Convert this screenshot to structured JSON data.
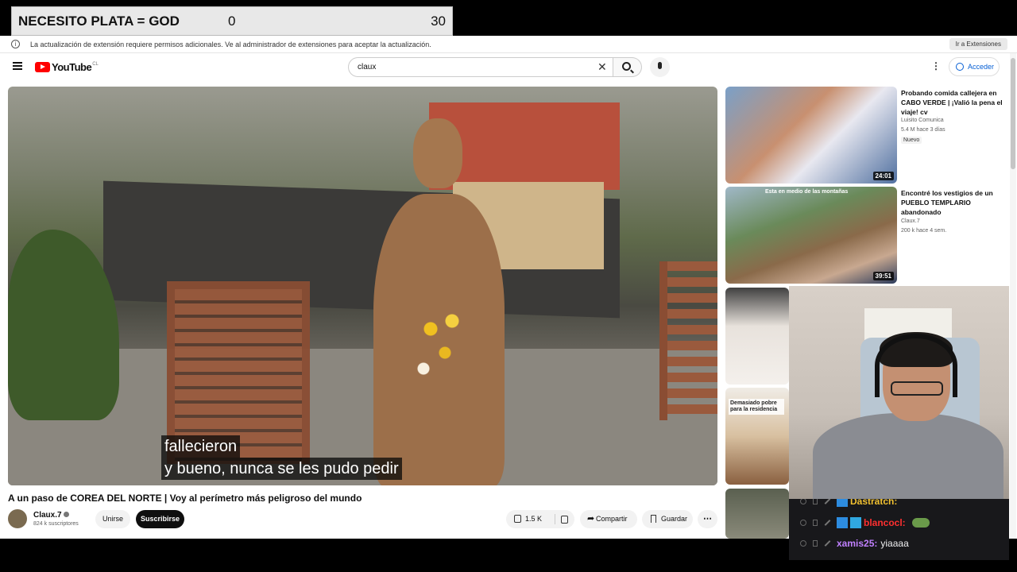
{
  "goal_overlay": {
    "title": "NECESITO PLATA = GOD",
    "current": "0",
    "target": "30"
  },
  "notice": {
    "text": "La actualización de extensión requiere permisos adicionales. Ve al administrador de extensiones para aceptar la actualización.",
    "button": "Ir a Extensiones"
  },
  "header": {
    "logo_text": "YouTube",
    "country_code": "CL",
    "search_value": "claux",
    "signin_label": "Acceder"
  },
  "player": {
    "caption_line1": "fallecieron",
    "caption_line2": "y bueno, nunca se les pudo pedir"
  },
  "video": {
    "title": "A un paso de COREA DEL NORTE | Voy al perímetro más peligroso del mundo",
    "channel": "Claux.7",
    "subscribers": "824 k suscriptores",
    "join_label": "Unirse",
    "subscribe_label": "Suscribirse",
    "likes": "1.5 K",
    "share_label": "Compartir",
    "save_label": "Guardar"
  },
  "recommendations": [
    {
      "title": "Probando comida callejera en CABO VERDE | ¡Valió la pena el viaje! cv",
      "channel": "Luisito Comunica",
      "meta": "5.4 M   hace 3 días",
      "badge": "Nuevo",
      "duration": "24:01"
    },
    {
      "title": "Encontré los vestigios de un PUEBLO TEMPLARIO abandonado",
      "channel": "Claux.7",
      "meta": "200 k   hace 4 sem.",
      "duration": "39:51",
      "thumb_text": "Esta en medio de las montañas"
    },
    {
      "thumb_text": "Demasiado pobre para la residencia"
    }
  ],
  "chat": [
    {
      "user": "Dastratch:",
      "user_color": "#f0c030",
      "message": ""
    },
    {
      "user": "blancocl:",
      "user_color": "#ff3030",
      "message": ""
    },
    {
      "user": "xamis25:",
      "user_color": "#c080ff",
      "message": "yiaaaa"
    }
  ],
  "colors": {
    "youtube_red": "#ff0000",
    "signin_blue": "#065fd4",
    "chat_bg": "#18181b"
  }
}
